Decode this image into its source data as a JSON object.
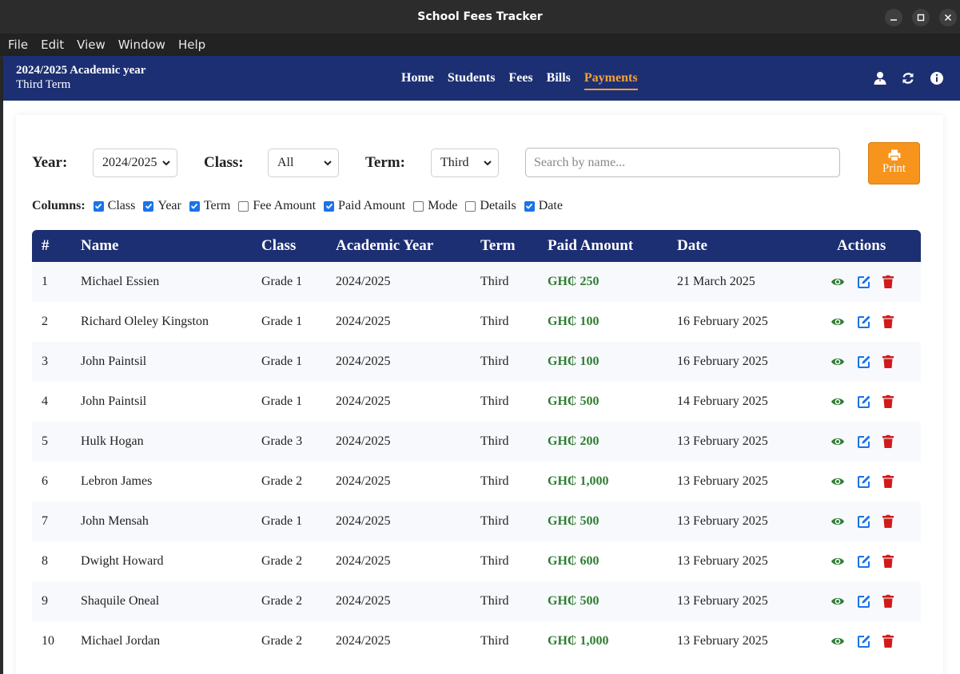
{
  "window": {
    "title": "School Fees Tracker"
  },
  "menu": [
    "File",
    "Edit",
    "View",
    "Window",
    "Help"
  ],
  "header": {
    "academic_year": "2024/2025 Academic year",
    "term": "Third Term",
    "nav": [
      "Home",
      "Students",
      "Fees",
      "Bills",
      "Payments"
    ],
    "active_nav": "Payments",
    "icons": [
      "user-icon",
      "refresh-icon",
      "info-icon"
    ]
  },
  "filters": {
    "year_label": "Year:",
    "year_value": "2024/2025",
    "class_label": "Class:",
    "class_value": "All",
    "term_label": "Term:",
    "term_value": "Third",
    "search_placeholder": "Search by name...",
    "print_label": "Print"
  },
  "columns": {
    "label": "Columns:",
    "options": [
      {
        "label": "Class",
        "checked": true
      },
      {
        "label": "Year",
        "checked": true
      },
      {
        "label": "Term",
        "checked": true
      },
      {
        "label": "Fee Amount",
        "checked": false
      },
      {
        "label": "Paid Amount",
        "checked": true
      },
      {
        "label": "Mode",
        "checked": false
      },
      {
        "label": "Details",
        "checked": false
      },
      {
        "label": "Date",
        "checked": true
      }
    ]
  },
  "table": {
    "headers": [
      "#",
      "Name",
      "Class",
      "Academic Year",
      "Term",
      "Paid Amount",
      "Date",
      "Actions"
    ],
    "rows": [
      [
        "1",
        "Michael Essien",
        "Grade 1",
        "2024/2025",
        "Third",
        "GH₵ 250",
        "21 March 2025"
      ],
      [
        "2",
        "Richard Oleley Kingston",
        "Grade 1",
        "2024/2025",
        "Third",
        "GH₵ 100",
        "16 February 2025"
      ],
      [
        "3",
        "John Paintsil",
        "Grade 1",
        "2024/2025",
        "Third",
        "GH₵ 100",
        "16 February 2025"
      ],
      [
        "4",
        "John Paintsil",
        "Grade 1",
        "2024/2025",
        "Third",
        "GH₵ 500",
        "14 February 2025"
      ],
      [
        "5",
        "Hulk Hogan",
        "Grade 3",
        "2024/2025",
        "Third",
        "GH₵ 200",
        "13 February 2025"
      ],
      [
        "6",
        "Lebron James",
        "Grade 2",
        "2024/2025",
        "Third",
        "GH₵ 1,000",
        "13 February 2025"
      ],
      [
        "7",
        "John Mensah",
        "Grade 1",
        "2024/2025",
        "Third",
        "GH₵ 500",
        "13 February 2025"
      ],
      [
        "8",
        "Dwight Howard",
        "Grade 2",
        "2024/2025",
        "Third",
        "GH₵ 600",
        "13 February 2025"
      ],
      [
        "9",
        "Shaquile Oneal",
        "Grade 2",
        "2024/2025",
        "Third",
        "GH₵ 500",
        "13 February 2025"
      ],
      [
        "10",
        "Michael Jordan",
        "Grade 2",
        "2024/2025",
        "Third",
        "GH₵ 1,000",
        "13 February 2025"
      ]
    ],
    "action_icons": [
      "view-icon",
      "edit-icon",
      "delete-icon"
    ]
  },
  "colors": {
    "header_bg": "#1d2f73",
    "accent": "#f7a135",
    "print_bg": "#f7941d",
    "paid_green": "#2e7d32",
    "view_green": "#2e7d32",
    "edit_blue": "#1a73e8",
    "delete_red": "#d11a1a"
  }
}
